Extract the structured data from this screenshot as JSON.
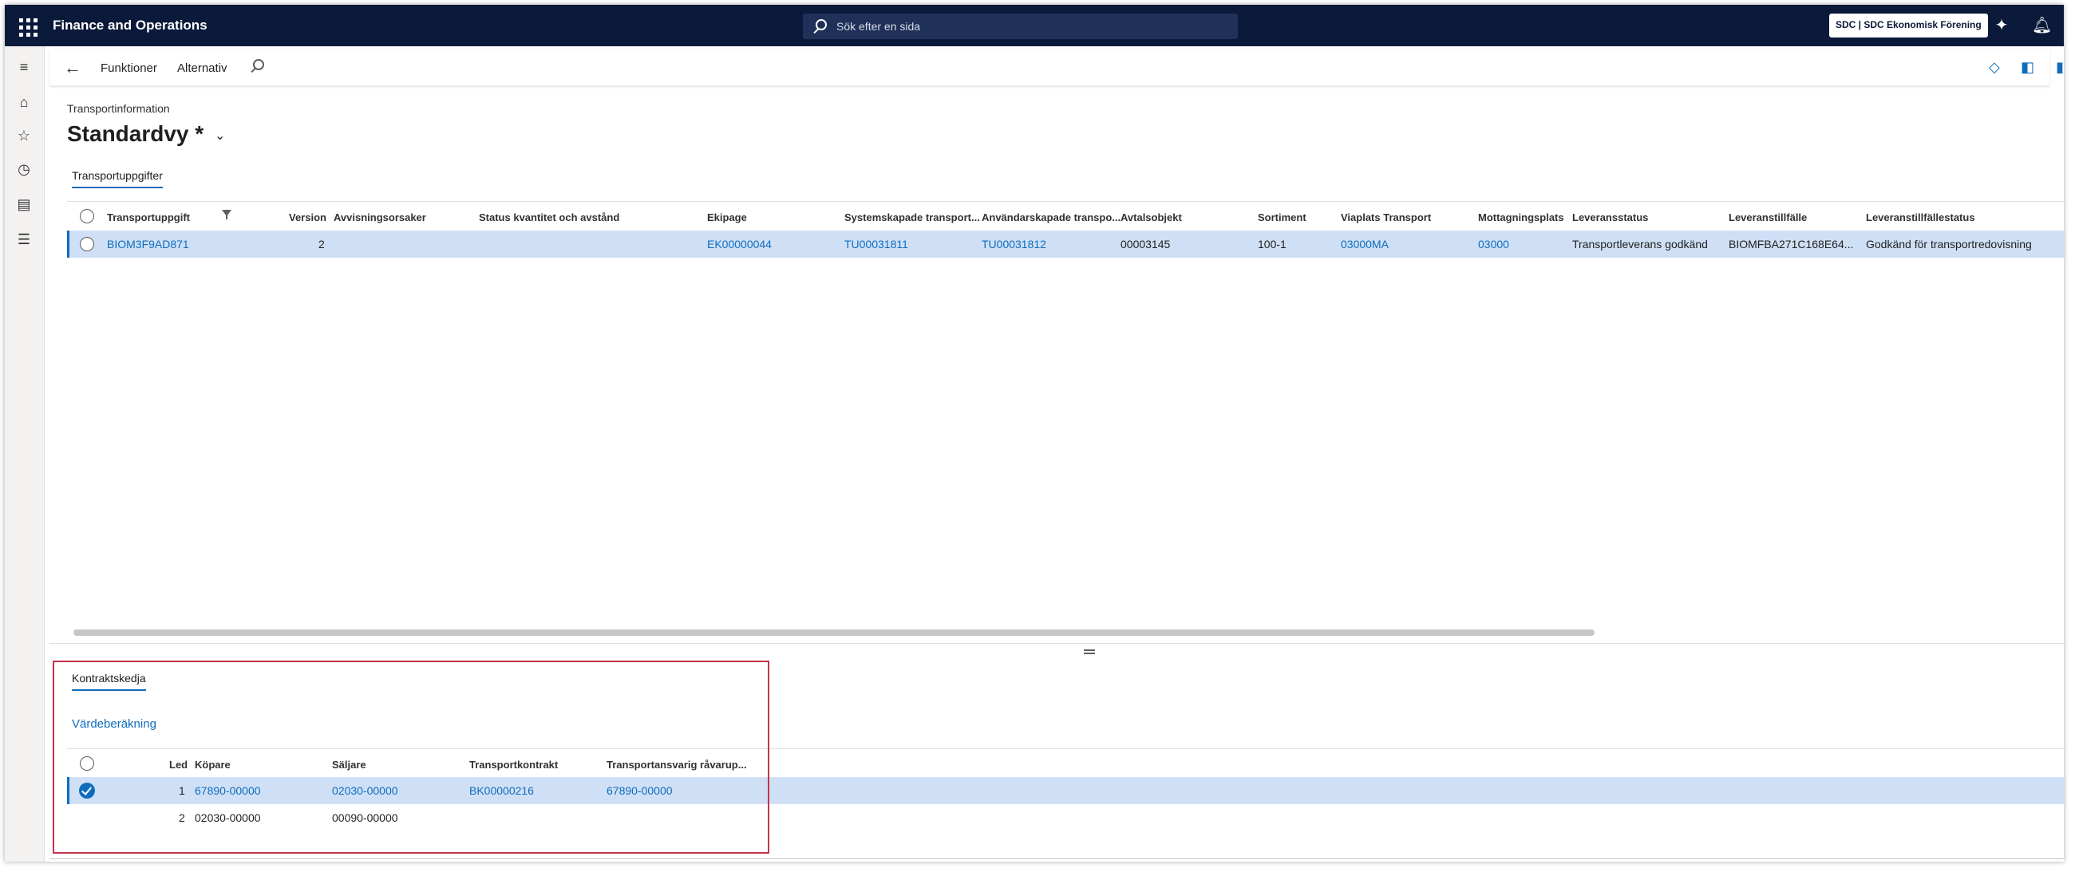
{
  "app": {
    "name": "Finance and Operations",
    "search_placeholder": "Sök efter en sida",
    "company": "SDC | SDC Ekonomisk Förening"
  },
  "actionbar": {
    "functions": "Funktioner",
    "options": "Alternativ"
  },
  "page": {
    "caption": "Transportinformation",
    "view_title": "Standardvy",
    "view_modified": "*",
    "tab": "Transportuppgifter"
  },
  "grid": {
    "columns": {
      "transportuppgift": "Transportuppgift",
      "version": "Version",
      "avvisningsorsaker": "Avvisningsorsaker",
      "status": "Status kvantitet och avstånd",
      "ekipage": "Ekipage",
      "systemskapade": "Systemskapade transport...",
      "anvandarskapade": "Användarskapade transpo...",
      "avtalsobjekt": "Avtalsobjekt",
      "sortiment": "Sortiment",
      "viaplats": "Viaplats Transport",
      "mottagningsplats": "Mottagningsplats",
      "leveransstatus": "Leveransstatus",
      "leveranstillfalle": "Leveranstillfälle",
      "leveranstillfallestatus": "Leveranstillfällestatus"
    },
    "rows": [
      {
        "transportuppgift": "BIOM3F9AD871",
        "version": "2",
        "ekipage": "EK00000044",
        "systemskapade": "TU00031811",
        "anvandarskapade": "TU00031812",
        "avtalsobjekt": "00003145",
        "sortiment": "100-1",
        "viaplats": "03000MA",
        "mottagningsplats": "03000",
        "leveransstatus": "Transportleverans godkänd",
        "leveranstillfalle": "BIOMFBA271C168E64...",
        "leveranstillfallestatus": "Godkänd för transportredovisning"
      }
    ]
  },
  "lower": {
    "tab": "Kontraktskedja",
    "link": "Värdeberäkning",
    "columns": {
      "led": "Led",
      "kopare": "Köpare",
      "saljare": "Säljare",
      "transportkontrakt": "Transportkontrakt",
      "ansvarig": "Transportansvarig råvarup..."
    },
    "rows": [
      {
        "led": "1",
        "kopare": "67890-00000",
        "saljare": "02030-00000",
        "transportkontrakt": "BK00000216",
        "ansvarig": "67890-00000"
      },
      {
        "led": "2",
        "kopare": "02030-00000",
        "saljare": "00090-00000",
        "transportkontrakt": "",
        "ansvarig": ""
      }
    ]
  },
  "colors": {
    "topbar": "#0b1a3a",
    "accent": "#0f6cbd",
    "selected_row": "#cfe0f6",
    "highlight_box": "#c4314b"
  }
}
